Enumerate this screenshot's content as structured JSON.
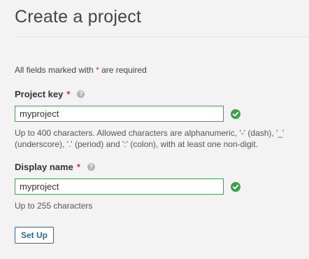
{
  "page": {
    "title": "Create a project"
  },
  "form": {
    "required_note_prefix": "All fields marked with",
    "required_mark": "*",
    "required_note_suffix": "are required",
    "fields": [
      {
        "label": "Project key",
        "value": "myproject",
        "help_glyph": "?",
        "hint": "Up to 400 characters. Allowed characters are alphanumeric, '-' (dash), '_' (underscore), '.' (period) and ':' (colon), with at least one non-digit."
      },
      {
        "label": "Display name",
        "value": "myproject",
        "help_glyph": "?",
        "hint": "Up to 255 characters"
      }
    ],
    "submit_label": "Set Up"
  },
  "icons": {
    "help": "help-circle-icon",
    "valid": "check-circle-icon"
  },
  "colors": {
    "valid_green": "#3da04b",
    "required_red": "#d02f3a",
    "button_blue": "#236a97"
  }
}
